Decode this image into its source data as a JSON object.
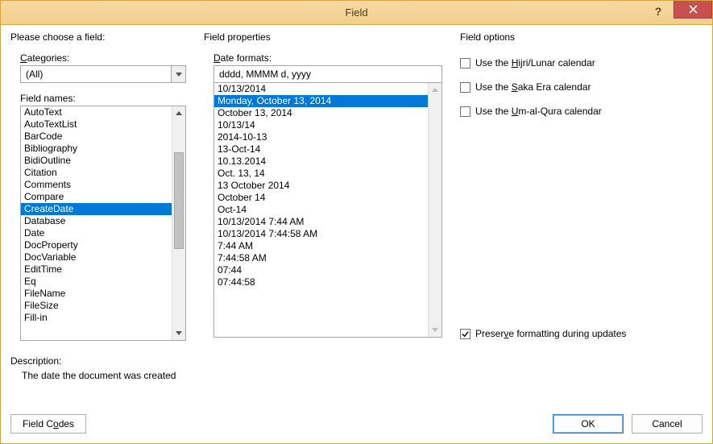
{
  "window": {
    "title": "Field"
  },
  "left": {
    "section": "Please choose a field:",
    "categories_label_pre": "",
    "categories_u": "C",
    "categories_label_post": "ategories:",
    "categories_value": "(All)",
    "fieldnames_label": "Field names:",
    "fieldnames": [
      "AutoText",
      "AutoTextList",
      "BarCode",
      "Bibliography",
      "BidiOutline",
      "Citation",
      "Comments",
      "Compare",
      "CreateDate",
      "Database",
      "Date",
      "DocProperty",
      "DocVariable",
      "EditTime",
      "Eq",
      "FileName",
      "FileSize",
      "Fill-in"
    ],
    "fieldnames_selected_index": 8
  },
  "middle": {
    "section": "Field properties",
    "dateformats_label_pre": "",
    "dateformats_u": "D",
    "dateformats_label_post": "ate formats:",
    "format_value": "dddd, MMMM d, yyyy",
    "formats": [
      "10/13/2014",
      "Monday, October 13, 2014",
      "October 13, 2014",
      "10/13/14",
      "2014-10-13",
      "13-Oct-14",
      "10.13.2014",
      "Oct. 13, 14",
      "13 October 2014",
      "October 14",
      "Oct-14",
      "10/13/2014 7:44 AM",
      "10/13/2014 7:44:58 AM",
      "7:44 AM",
      "7:44:58 AM",
      "07:44",
      "07:44:58"
    ],
    "formats_selected_index": 1
  },
  "right": {
    "section": "Field options",
    "opt1_pre": "Use the ",
    "opt1_u": "H",
    "opt1_post": "ijri/Lunar calendar",
    "opt2_pre": "Use the ",
    "opt2_u": "S",
    "opt2_post": "aka Era calendar",
    "opt3_pre": "Use the ",
    "opt3_u": "U",
    "opt3_post": "m-al-Qura calendar",
    "preserve_pre": "Preser",
    "preserve_u": "v",
    "preserve_post": "e formatting during updates",
    "preserve_checked": true
  },
  "description": {
    "label": "Description:",
    "text": "The date the document was created"
  },
  "buttons": {
    "field_codes_pre": "Field C",
    "field_codes_u": "o",
    "field_codes_post": "des",
    "ok": "OK",
    "cancel": "Cancel"
  }
}
